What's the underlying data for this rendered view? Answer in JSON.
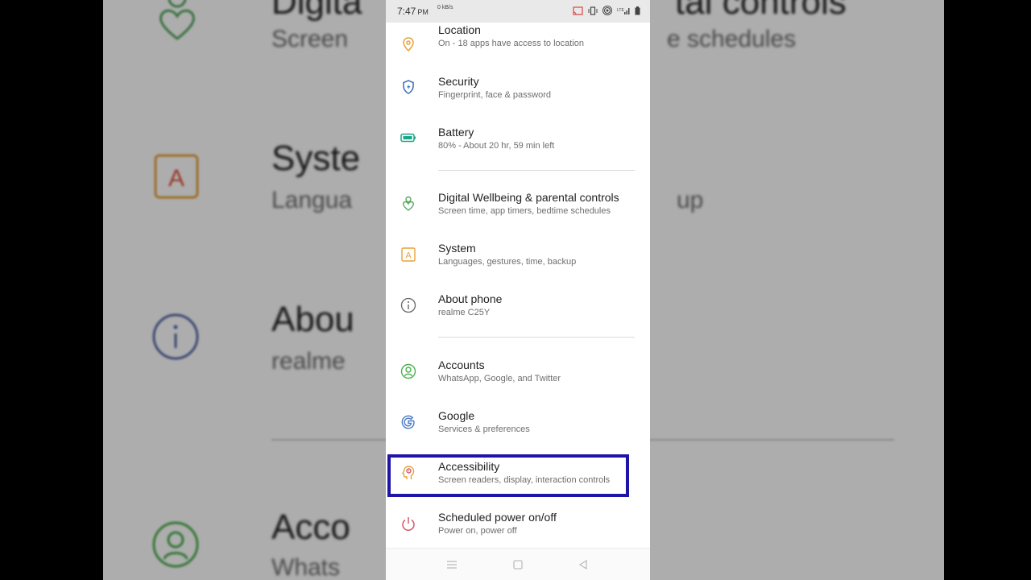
{
  "background": {
    "rows": [
      {
        "title": "Digita",
        "right_title": "tal controls",
        "sub": "Screen",
        "right_sub": "e schedules"
      },
      {
        "title": "Syste",
        "sub": "Langua",
        "right_sub": "up"
      },
      {
        "title": "Abou",
        "sub": "realme"
      },
      {
        "title": "Acco",
        "sub": "Whats"
      }
    ]
  },
  "status_bar": {
    "time": "7:47",
    "ampm": "PM",
    "data_rate": "0 kB/s"
  },
  "settings": [
    {
      "title": "Location",
      "subtitle": "On - 18 apps have access to location",
      "icon": "location-icon",
      "color": "#e8a13a"
    },
    {
      "title": "Security",
      "subtitle": "Fingerprint, face & password",
      "icon": "shield-icon",
      "color": "#3b6fb6"
    },
    {
      "title": "Battery",
      "subtitle": "80% - About 20 hr, 59 min left",
      "icon": "battery-icon",
      "color": "#1aa586"
    },
    {
      "title": "Digital Wellbeing & parental controls",
      "subtitle": "Screen time, app timers, bedtime schedules",
      "icon": "wellbeing-icon",
      "color": "#56a85f"
    },
    {
      "title": "System",
      "subtitle": "Languages, gestures, time, backup",
      "icon": "system-icon",
      "color": "#e8a13a"
    },
    {
      "title": "About phone",
      "subtitle": "realme C25Y",
      "icon": "info-icon",
      "color": "#666666"
    },
    {
      "title": "Accounts",
      "subtitle": "WhatsApp, Google, and Twitter",
      "icon": "accounts-icon",
      "color": "#4caf50"
    },
    {
      "title": "Google",
      "subtitle": "Services & preferences",
      "icon": "google-icon",
      "color": "#4a78c2"
    },
    {
      "title": "Accessibility",
      "subtitle": "Screen readers, display, interaction controls",
      "icon": "accessibility-icon",
      "color": "#e8a13a"
    },
    {
      "title": "Scheduled power on/off",
      "subtitle": "Power on, power off",
      "icon": "power-icon",
      "color": "#d15a6a"
    }
  ],
  "colors": {
    "highlight_border": "#1f14a8",
    "status_bar_bg": "#e9e9e9"
  }
}
